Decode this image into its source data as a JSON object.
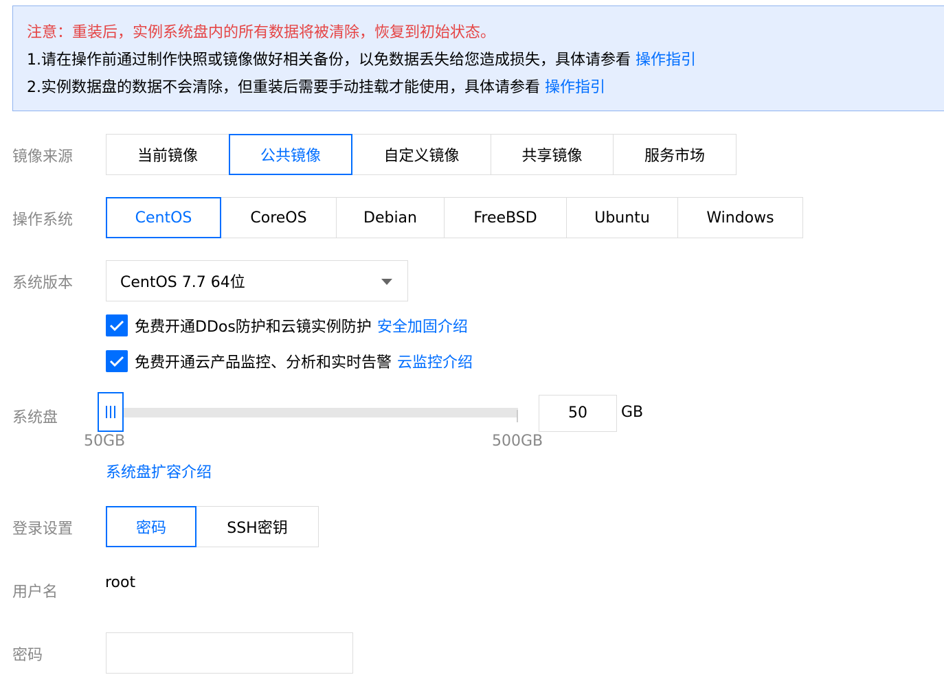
{
  "notice": {
    "warning": "注意：重装后，实例系统盘内的所有数据将被清除，恢复到初始状态。",
    "line1_text": "1.请在操作前通过制作快照或镜像做好相关备份，以免数据丢失给您造成损失，具体请参看",
    "line1_link": "操作指引",
    "line2_text": "2.实例数据盘的数据不会清除，但重装后需要手动挂载才能使用，具体请参看",
    "line2_link": "操作指引"
  },
  "image_source": {
    "label": "镜像来源",
    "options": [
      "当前镜像",
      "公共镜像",
      "自定义镜像",
      "共享镜像",
      "服务市场"
    ],
    "selected": "公共镜像"
  },
  "os": {
    "label": "操作系统",
    "options": [
      "CentOS",
      "CoreOS",
      "Debian",
      "FreeBSD",
      "Ubuntu",
      "Windows"
    ],
    "selected": "CentOS"
  },
  "version": {
    "label": "系统版本",
    "value": "CentOS 7.7 64位"
  },
  "checks": [
    {
      "text": "免费开通DDos防护和云镜实例防护",
      "link": "安全加固介绍",
      "checked": true
    },
    {
      "text": "免费开通云产品监控、分析和实时告警",
      "link": "云监控介绍",
      "checked": true
    }
  ],
  "system_disk": {
    "label": "系统盘",
    "min_label": "50GB",
    "max_label": "500GB",
    "value": "50",
    "unit": "GB",
    "link": "系统盘扩容介绍"
  },
  "login": {
    "label": "登录设置",
    "options": [
      "密码",
      "SSH密钥"
    ],
    "selected": "密码"
  },
  "username": {
    "label": "用户名",
    "value": "root"
  },
  "password": {
    "label": "密码",
    "value": ""
  },
  "colors": {
    "accent": "#006eff",
    "warning": "#e54545",
    "notice_bg": "#e5eefe"
  }
}
